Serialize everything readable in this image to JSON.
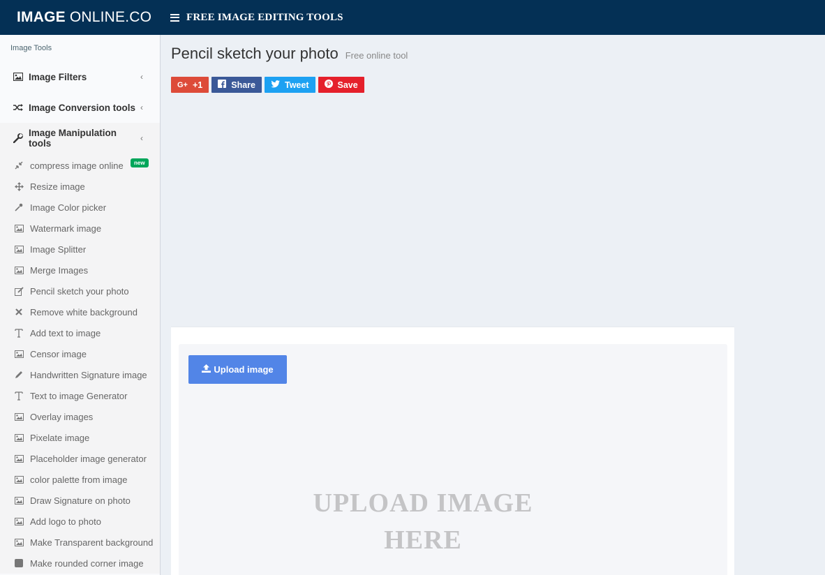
{
  "header": {
    "logo_bold": "IMAGE",
    "logo_light": "ONLINE.CO",
    "nav_title": "FREE IMAGE EDITING TOOLS"
  },
  "sidebar": {
    "header": "Image Tools",
    "groups": [
      {
        "label": "Image Filters",
        "icon": "image-icon"
      },
      {
        "label": "Image Conversion tools",
        "icon": "shuffle-icon"
      },
      {
        "label": "Image Manipulation tools",
        "icon": "wrench-icon"
      }
    ],
    "items": [
      {
        "label": "compress image online",
        "icon": "compress-icon",
        "badge": "new"
      },
      {
        "label": "Resize image",
        "icon": "move-arrows-icon"
      },
      {
        "label": "Image Color picker",
        "icon": "eyedropper-icon"
      },
      {
        "label": "Watermark image",
        "icon": "image-icon"
      },
      {
        "label": "Image Splitter",
        "icon": "image-icon"
      },
      {
        "label": "Merge Images",
        "icon": "image-icon"
      },
      {
        "label": "Pencil sketch your photo",
        "icon": "edit-icon"
      },
      {
        "label": "Remove white background",
        "icon": "close-icon"
      },
      {
        "label": "Add text to image",
        "icon": "text-icon"
      },
      {
        "label": "Censor image",
        "icon": "image-icon"
      },
      {
        "label": "Handwritten Signature image",
        "icon": "pencil-icon"
      },
      {
        "label": "Text to image Generator",
        "icon": "text-icon"
      },
      {
        "label": "Overlay images",
        "icon": "image-icon"
      },
      {
        "label": "Pixelate image",
        "icon": "image-icon"
      },
      {
        "label": "Placeholder image generator",
        "icon": "image-icon"
      },
      {
        "label": "color palette from image",
        "icon": "image-icon"
      },
      {
        "label": "Draw Signature on photo",
        "icon": "image-icon"
      },
      {
        "label": "Add logo to photo",
        "icon": "image-icon"
      },
      {
        "label": "Make Transparent background",
        "icon": "image-icon"
      },
      {
        "label": "Make rounded corner image",
        "icon": "square-icon"
      }
    ]
  },
  "main": {
    "title": "Pencil sketch your photo",
    "subtitle": "Free online tool",
    "share": {
      "gplus": "+1",
      "facebook": "Share",
      "twitter": "Tweet",
      "pinterest": "Save"
    },
    "upload_label": "Upload image",
    "dropzone_text": "UPLOAD IMAGE HERE"
  },
  "colors": {
    "header_bg": "#043055",
    "upload_button": "#5285e7",
    "badge_new": "#00a65a"
  }
}
